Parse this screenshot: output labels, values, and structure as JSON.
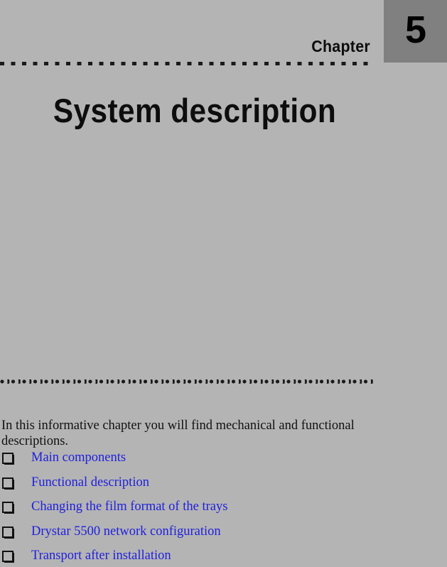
{
  "page": {
    "background_color": "#b4b4b4",
    "accent_box_color": "#808080",
    "link_color": "#2020dd",
    "text_color": "#111111"
  },
  "header": {
    "chapter_label": "Chapter",
    "chapter_number": "5"
  },
  "title": "System description",
  "intro": "In this informative chapter you will find mechanical and functional descriptions.",
  "toc": {
    "bullet_icon": "hollow-square-shadow-bullet",
    "items": [
      {
        "label": "Main components"
      },
      {
        "label": "Functional description"
      },
      {
        "label": "Changing the film format of the trays"
      },
      {
        "label": "Drystar 5500 network configuration"
      },
      {
        "label": "Transport after installation"
      }
    ]
  }
}
